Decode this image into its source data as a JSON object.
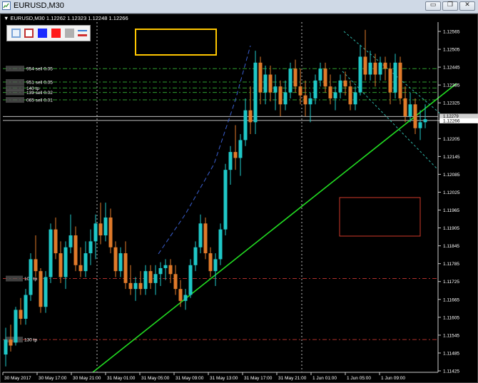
{
  "window": {
    "title": "EURUSD,M30",
    "minimize_glyph": "▭",
    "restore_glyph": "❐",
    "close_glyph": "✕"
  },
  "chart_header": {
    "symbol_line": "▼ EURUSD,M30  1.12262 1.12323 1.12248 1.12266"
  },
  "toolbar": {
    "tools": [
      "rectangle-outline-blue",
      "rectangle-outline-red",
      "fill-blue",
      "fill-red",
      "fill-gray",
      "line-style"
    ]
  },
  "colors": {
    "bull": "#1fc7c7",
    "bear": "#e07a2a",
    "trendline": "#22dd22",
    "order_line": "#2f9e2f",
    "stop_line": "#b0302a",
    "bid_line": "#c0c0c0",
    "yellow_box": "#ffc700",
    "red_box": "#d03a2a",
    "channel": "#2fb5a8",
    "projection": "#3a5fd0"
  },
  "price_axis": {
    "labels": [
      "1.12565",
      "1.12505",
      "1.12445",
      "1.12385",
      "1.12325",
      "1.12265",
      "1.12205",
      "1.12145",
      "1.12085",
      "1.12025",
      "1.11965",
      "1.11905",
      "1.11845",
      "1.11785",
      "1.11725",
      "1.11665",
      "1.11605",
      "1.11545",
      "1.11485",
      "1.11425"
    ],
    "current_price": "1.12266",
    "upper_price": "1.12279"
  },
  "time_axis": {
    "labels": [
      "30 May 2017",
      "30 May 17:00",
      "30 May 21:00",
      "31 May 01:00",
      "31 May 05:00",
      "31 May 09:00",
      "31 May 13:00",
      "31 May 17:00",
      "31 May 21:00",
      "1 Jun 01:00",
      "1 Jun 05:00",
      "1 Jun 09:00"
    ]
  },
  "order_lines": [
    {
      "label": "954 sell 0.05",
      "price": 1.1244
    },
    {
      "label": "951 sell 0.05",
      "price": 1.12395
    },
    {
      "label": "140 tp",
      "price": 1.12375
    },
    {
      "label": "139 sell 0.02",
      "price": 1.1236
    },
    {
      "label": "065 sell 0.01",
      "price": 1.12335
    }
  ],
  "tp_lines": [
    {
      "label": "105 tp",
      "price": 1.11735
    },
    {
      "label": "130 tp",
      "price": 1.1153
    }
  ],
  "chart_data": {
    "type": "candlestick",
    "symbol": "EURUSD",
    "timeframe": "M30",
    "ylim": [
      1.11425,
      1.126
    ],
    "candles": [
      [
        1.1148,
        1.1157,
        1.1144,
        1.1153
      ],
      [
        1.1153,
        1.1158,
        1.1149,
        1.1151
      ],
      [
        1.1152,
        1.1164,
        1.1151,
        1.1163
      ],
      [
        1.1163,
        1.1167,
        1.1158,
        1.116
      ],
      [
        1.116,
        1.117,
        1.1158,
        1.1168
      ],
      [
        1.1168,
        1.1182,
        1.1166,
        1.118
      ],
      [
        1.118,
        1.1188,
        1.1174,
        1.1176
      ],
      [
        1.1176,
        1.1177,
        1.1162,
        1.1164
      ],
      [
        1.1164,
        1.1176,
        1.1162,
        1.1174
      ],
      [
        1.1174,
        1.1192,
        1.1172,
        1.119
      ],
      [
        1.119,
        1.1194,
        1.118,
        1.1182
      ],
      [
        1.1182,
        1.1186,
        1.1172,
        1.1174
      ],
      [
        1.1174,
        1.1186,
        1.117,
        1.1184
      ],
      [
        1.1184,
        1.1195,
        1.1182,
        1.1188
      ],
      [
        1.1188,
        1.1191,
        1.1176,
        1.1178
      ],
      [
        1.1178,
        1.1184,
        1.1174,
        1.1176
      ],
      [
        1.1176,
        1.1186,
        1.1174,
        1.1182
      ],
      [
        1.1182,
        1.119,
        1.1178,
        1.1186
      ],
      [
        1.1186,
        1.1195,
        1.118,
        1.1192
      ],
      [
        1.1192,
        1.1199,
        1.1185,
        1.1188
      ],
      [
        1.1188,
        1.1199,
        1.1186,
        1.1194
      ],
      [
        1.1194,
        1.1197,
        1.1182,
        1.1184
      ],
      [
        1.1184,
        1.1186,
        1.1174,
        1.1176
      ],
      [
        1.1176,
        1.1184,
        1.1174,
        1.1182
      ],
      [
        1.1182,
        1.1186,
        1.117,
        1.1172
      ],
      [
        1.1172,
        1.1178,
        1.1168,
        1.117
      ],
      [
        1.117,
        1.1174,
        1.1166,
        1.1172
      ],
      [
        1.1172,
        1.1176,
        1.1168,
        1.117
      ],
      [
        1.117,
        1.1178,
        1.1168,
        1.1176
      ],
      [
        1.1176,
        1.1178,
        1.117,
        1.1172
      ],
      [
        1.1172,
        1.1178,
        1.1168,
        1.1175
      ],
      [
        1.1175,
        1.1179,
        1.1171,
        1.1177
      ],
      [
        1.1177,
        1.118,
        1.1173,
        1.1178
      ],
      [
        1.1178,
        1.118,
        1.1172,
        1.1175
      ],
      [
        1.1175,
        1.1178,
        1.1168,
        1.117
      ],
      [
        1.117,
        1.1173,
        1.1164,
        1.1166
      ],
      [
        1.1166,
        1.117,
        1.1163,
        1.1168
      ],
      [
        1.1168,
        1.118,
        1.1167,
        1.1178
      ],
      [
        1.1178,
        1.1186,
        1.1176,
        1.1184
      ],
      [
        1.1184,
        1.1195,
        1.1182,
        1.1192
      ],
      [
        1.1192,
        1.1194,
        1.118,
        1.1182
      ],
      [
        1.1182,
        1.1184,
        1.1174,
        1.1176
      ],
      [
        1.1176,
        1.1182,
        1.1171,
        1.118
      ],
      [
        1.118,
        1.1192,
        1.1178,
        1.119
      ],
      [
        1.119,
        1.1212,
        1.1188,
        1.121
      ],
      [
        1.121,
        1.1218,
        1.1205,
        1.1216
      ],
      [
        1.1216,
        1.1225,
        1.121,
        1.1214
      ],
      [
        1.1214,
        1.1222,
        1.1208,
        1.122
      ],
      [
        1.122,
        1.1234,
        1.1218,
        1.123
      ],
      [
        1.123,
        1.1238,
        1.1222,
        1.1226
      ],
      [
        1.1226,
        1.125,
        1.1222,
        1.1246
      ],
      [
        1.1246,
        1.1248,
        1.1232,
        1.1236
      ],
      [
        1.1236,
        1.1245,
        1.1232,
        1.1242
      ],
      [
        1.1242,
        1.1245,
        1.1233,
        1.1236
      ],
      [
        1.1236,
        1.1242,
        1.123,
        1.1238
      ],
      [
        1.1238,
        1.124,
        1.1228,
        1.1232
      ],
      [
        1.1232,
        1.124,
        1.123,
        1.1236
      ],
      [
        1.1236,
        1.1246,
        1.1234,
        1.1244
      ],
      [
        1.1244,
        1.1247,
        1.1236,
        1.1238
      ],
      [
        1.1238,
        1.1244,
        1.1232,
        1.1235
      ],
      [
        1.1235,
        1.124,
        1.1228,
        1.1232
      ],
      [
        1.1232,
        1.1236,
        1.1226,
        1.1234
      ],
      [
        1.1234,
        1.1242,
        1.1232,
        1.124
      ],
      [
        1.124,
        1.1246,
        1.1238,
        1.1244
      ],
      [
        1.1244,
        1.1246,
        1.1236,
        1.1238
      ],
      [
        1.1238,
        1.1242,
        1.1232,
        1.1234
      ],
      [
        1.1234,
        1.1238,
        1.123,
        1.1236
      ],
      [
        1.1236,
        1.1242,
        1.1234,
        1.124
      ],
      [
        1.124,
        1.1243,
        1.1235,
        1.1238
      ],
      [
        1.1238,
        1.124,
        1.123,
        1.1232
      ],
      [
        1.1232,
        1.1238,
        1.123,
        1.1236
      ],
      [
        1.1236,
        1.1252,
        1.1235,
        1.1248
      ],
      [
        1.1248,
        1.1257,
        1.124,
        1.1242
      ],
      [
        1.1242,
        1.125,
        1.124,
        1.1246
      ],
      [
        1.1246,
        1.1249,
        1.1238,
        1.1242
      ],
      [
        1.1242,
        1.1248,
        1.124,
        1.1246
      ],
      [
        1.1246,
        1.1248,
        1.124,
        1.1244
      ],
      [
        1.1244,
        1.1246,
        1.1232,
        1.1236
      ],
      [
        1.1236,
        1.1249,
        1.1234,
        1.1246
      ],
      [
        1.1246,
        1.1248,
        1.1232,
        1.1234
      ],
      [
        1.1234,
        1.1238,
        1.1226,
        1.1228
      ],
      [
        1.1228,
        1.1236,
        1.1226,
        1.1232
      ],
      [
        1.1232,
        1.1234,
        1.1222,
        1.1224
      ],
      [
        1.1224,
        1.123,
        1.122,
        1.1226
      ],
      [
        1.1226,
        1.1232,
        1.1224,
        1.1227
      ]
    ]
  }
}
